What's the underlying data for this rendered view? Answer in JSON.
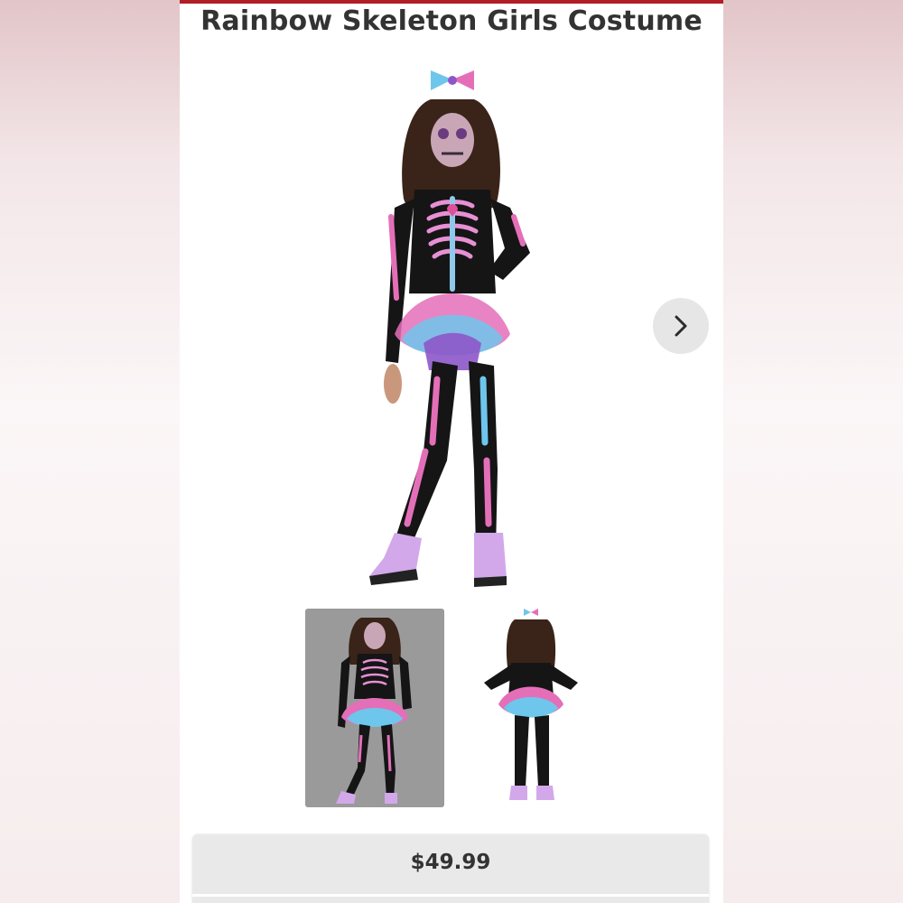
{
  "product": {
    "title": "Rainbow Skeleton Girls Costume",
    "price": "$49.99"
  },
  "gallery": {
    "main_image": "costume-front-photo",
    "next_icon": "chevron-right-icon",
    "thumbnails": [
      "costume-front-thumbnail",
      "costume-back-thumbnail"
    ]
  },
  "colors": {
    "accent": "#b21e26",
    "costume_pink": "#e46fb8",
    "costume_blue": "#6ec6ec",
    "costume_purple": "#8d57c9",
    "boot_lilac": "#d2a8ea"
  }
}
